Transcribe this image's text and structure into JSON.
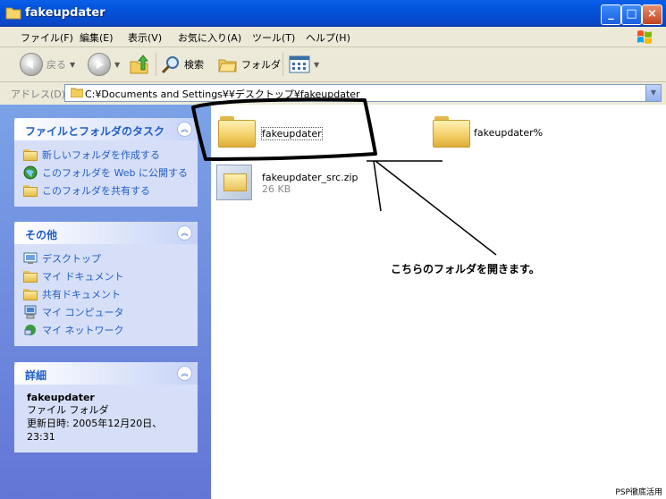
{
  "window": {
    "title": "fakeupdater",
    "buttons": {
      "minimize": "_",
      "maximize": "□",
      "close": "×"
    }
  },
  "menu": [
    "ファイル(F)",
    "編集(E)",
    "表示(V)",
    "お気に入り(A)",
    "ツール(T)",
    "ヘルプ(H)"
  ],
  "toolbar": {
    "back": "戻る",
    "search": "検索",
    "folders": "フォルダ"
  },
  "address": {
    "label": "アドレス(D)",
    "value": "C:¥Documents and Settings¥¥デスクトップ¥fakeupdater"
  },
  "tasks_panel": {
    "title": "ファイルとフォルダのタスク",
    "items": [
      "新しいフォルダを作成する",
      "このフォルダを Web に公開する",
      "このフォルダを共有する"
    ]
  },
  "other_panel": {
    "title": "その他",
    "items": [
      "デスクトップ",
      "マイ ドキュメント",
      "共有ドキュメント",
      "マイ コンピュータ",
      "マイ ネットワーク"
    ]
  },
  "details_panel": {
    "title": "詳細",
    "name": "fakeupdater",
    "type": "ファイル フォルダ",
    "modified": "更新日時: 2005年12月20日、23:31"
  },
  "files": [
    {
      "name": "fakeupdater",
      "kind": "folder"
    },
    {
      "name": "fakeupdater%",
      "kind": "folder"
    },
    {
      "name": "fakeupdater_src.zip",
      "size": "26 KB",
      "kind": "zip"
    }
  ],
  "annotation": "こちらのフォルダを開きます。",
  "footer": "PSP徹底活用",
  "colors": {
    "title_blue": "#0A5FE8",
    "link_blue": "#215DC6",
    "taskpane_blue": "#7BA2E7"
  }
}
